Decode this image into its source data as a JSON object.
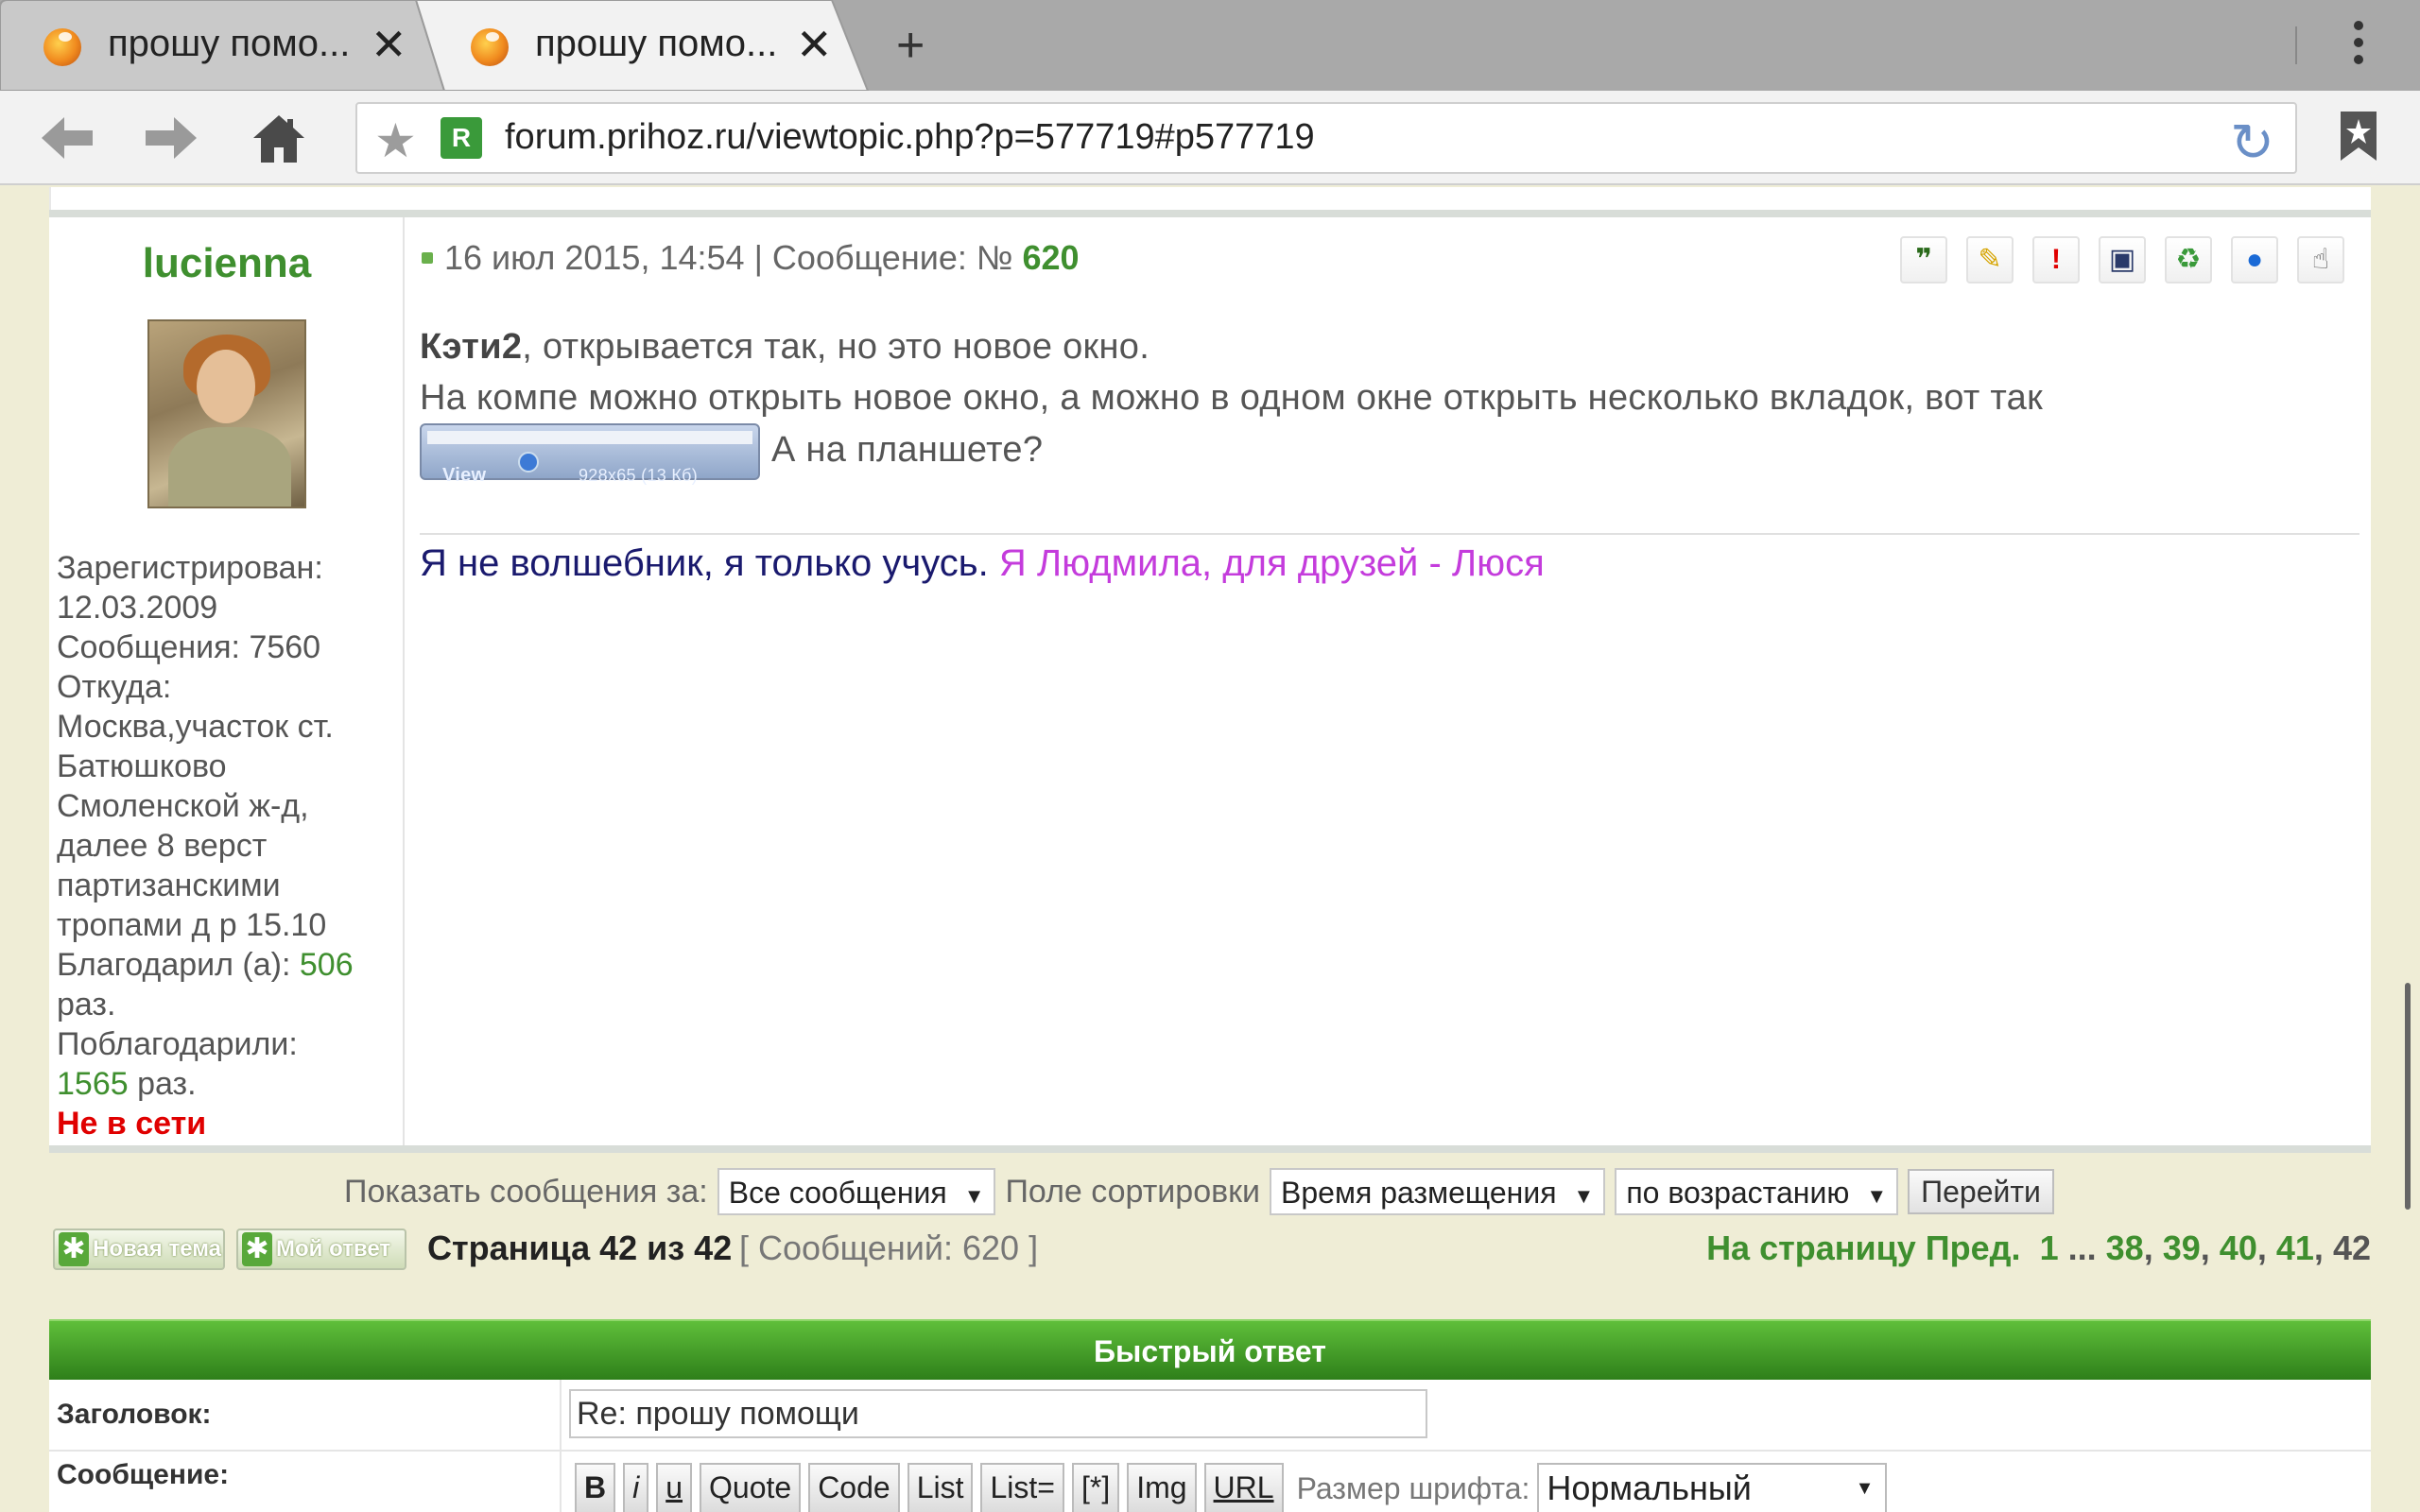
{
  "browser": {
    "tabs": [
      {
        "title": "прошу помо...",
        "active": false
      },
      {
        "title": "прошу помо...",
        "active": true
      }
    ],
    "new_tab_label": "+",
    "url": "forum.prihoz.ru/viewtopic.php?p=577719#p577719"
  },
  "post": {
    "author": "lucienna",
    "profile": {
      "registered_label": "Зарегистрирован:",
      "registered_value": "12.03.2009",
      "messages_label": "Сообщения:",
      "messages_value": "7560",
      "from_label": "Откуда:",
      "from_value": "Москва,участок ст. Батюшково Смоленской ж-д, далее 8 верст партизанскими тропами д р 15.10",
      "thanked_label": "Благодарил (а):",
      "thanked_value": "506",
      "thanked_suffix": "раз.",
      "was_thanked_label": "Поблагодарили:",
      "was_thanked_value": "1565",
      "was_thanked_suffix": "раз.",
      "status": "Не в сети"
    },
    "date": "16 июл 2015, 14:54",
    "number_label": "| Сообщение: №",
    "number": "620",
    "text": {
      "addressee": "Кэти2",
      "line1_rest": ", открывается так, но это новое окно.",
      "line2": "На компе можно открыть новое окно, а можно в одном окне открыть несколько вкладок, вот так",
      "line3_rest": "А на планшете?"
    },
    "attachment": {
      "view_label": "View",
      "size_label": "928x65 (13 Кб)"
    },
    "signature": {
      "part1": "Я не волшебник, я только учусь.",
      "part2": "Я Людмила, для друзей - Люся"
    },
    "icons": [
      "quote-icon",
      "edit-icon",
      "report-icon",
      "info-icon",
      "thanks-icon",
      "pm-icon",
      "like-icon"
    ]
  },
  "sortbar": {
    "show_label": "Показать сообщения за:",
    "show_value": "Все сообщения",
    "sort_field_label": "Поле сортировки",
    "sort_field_value": "Время размещения",
    "order_value": "по возрастанию",
    "go_label": "Перейти"
  },
  "pagination": {
    "new_topic_label": "Новая тема",
    "my_reply_label": "Мой ответ",
    "page_info": "Страница 42 из 42",
    "message_count": "[ Сообщений: 620 ]",
    "goto_label": "На страницу",
    "prev_label": "Пред.",
    "pages": [
      "1",
      "...",
      "38",
      "39",
      "40",
      "41",
      "42"
    ]
  },
  "quick_reply": {
    "title": "Быстрый ответ",
    "subject_label": "Заголовок:",
    "subject_value": "Re: прошу помощи",
    "message_label": "Сообщение:",
    "format_buttons": [
      "B",
      "i",
      "u",
      "Quote",
      "Code",
      "List",
      "List=",
      "[*]",
      "Img",
      "URL"
    ],
    "font_size_label": "Размер шрифта:",
    "font_size_value": "Нормальный"
  },
  "colors": {
    "accent_green": "#3f8f2f",
    "offline_red": "#e00000",
    "signature_navy": "#1a1a6e",
    "signature_purple": "#c43cdc",
    "page_bg": "#efedd6"
  }
}
